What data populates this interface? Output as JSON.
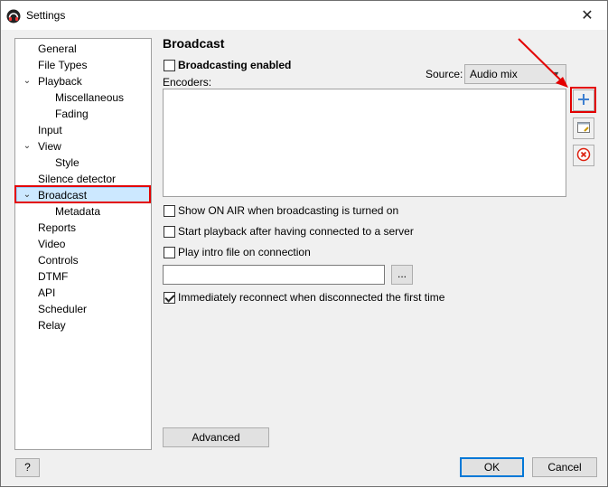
{
  "window": {
    "title": "Settings",
    "close_glyph": "✕"
  },
  "tree": {
    "items": [
      {
        "label": "General"
      },
      {
        "label": "File Types"
      },
      {
        "label": "Playback"
      },
      {
        "label": "Miscellaneous"
      },
      {
        "label": "Fading"
      },
      {
        "label": "Input"
      },
      {
        "label": "View"
      },
      {
        "label": "Style"
      },
      {
        "label": "Silence detector"
      },
      {
        "label": "Broadcast"
      },
      {
        "label": "Metadata"
      },
      {
        "label": "Reports"
      },
      {
        "label": "Video"
      },
      {
        "label": "Controls"
      },
      {
        "label": "DTMF"
      },
      {
        "label": "API"
      },
      {
        "label": "Scheduler"
      },
      {
        "label": "Relay"
      }
    ],
    "selected": "Broadcast"
  },
  "broadcast": {
    "title": "Broadcast",
    "enabled_label": "Broadcasting enabled",
    "enabled": false,
    "source_label": "Source:",
    "source_value": "Audio mix",
    "encoders_label": "Encoders:",
    "show_on_air_label": "Show ON AIR when broadcasting is turned on",
    "show_on_air": false,
    "start_playback_label": "Start playback after having connected to a server",
    "start_playback": false,
    "play_intro_label": "Play intro file on connection",
    "play_intro": false,
    "intro_file_value": "",
    "browse_label": "...",
    "reconnect_label": "Immediately reconnect when disconnected the first time",
    "reconnect": true,
    "advanced_label": "Advanced"
  },
  "buttons": {
    "help": "?",
    "ok": "OK",
    "cancel": "Cancel"
  },
  "colors": {
    "highlight": "#e30000",
    "selection": "#cce8ff",
    "accent": "#0078d7"
  }
}
